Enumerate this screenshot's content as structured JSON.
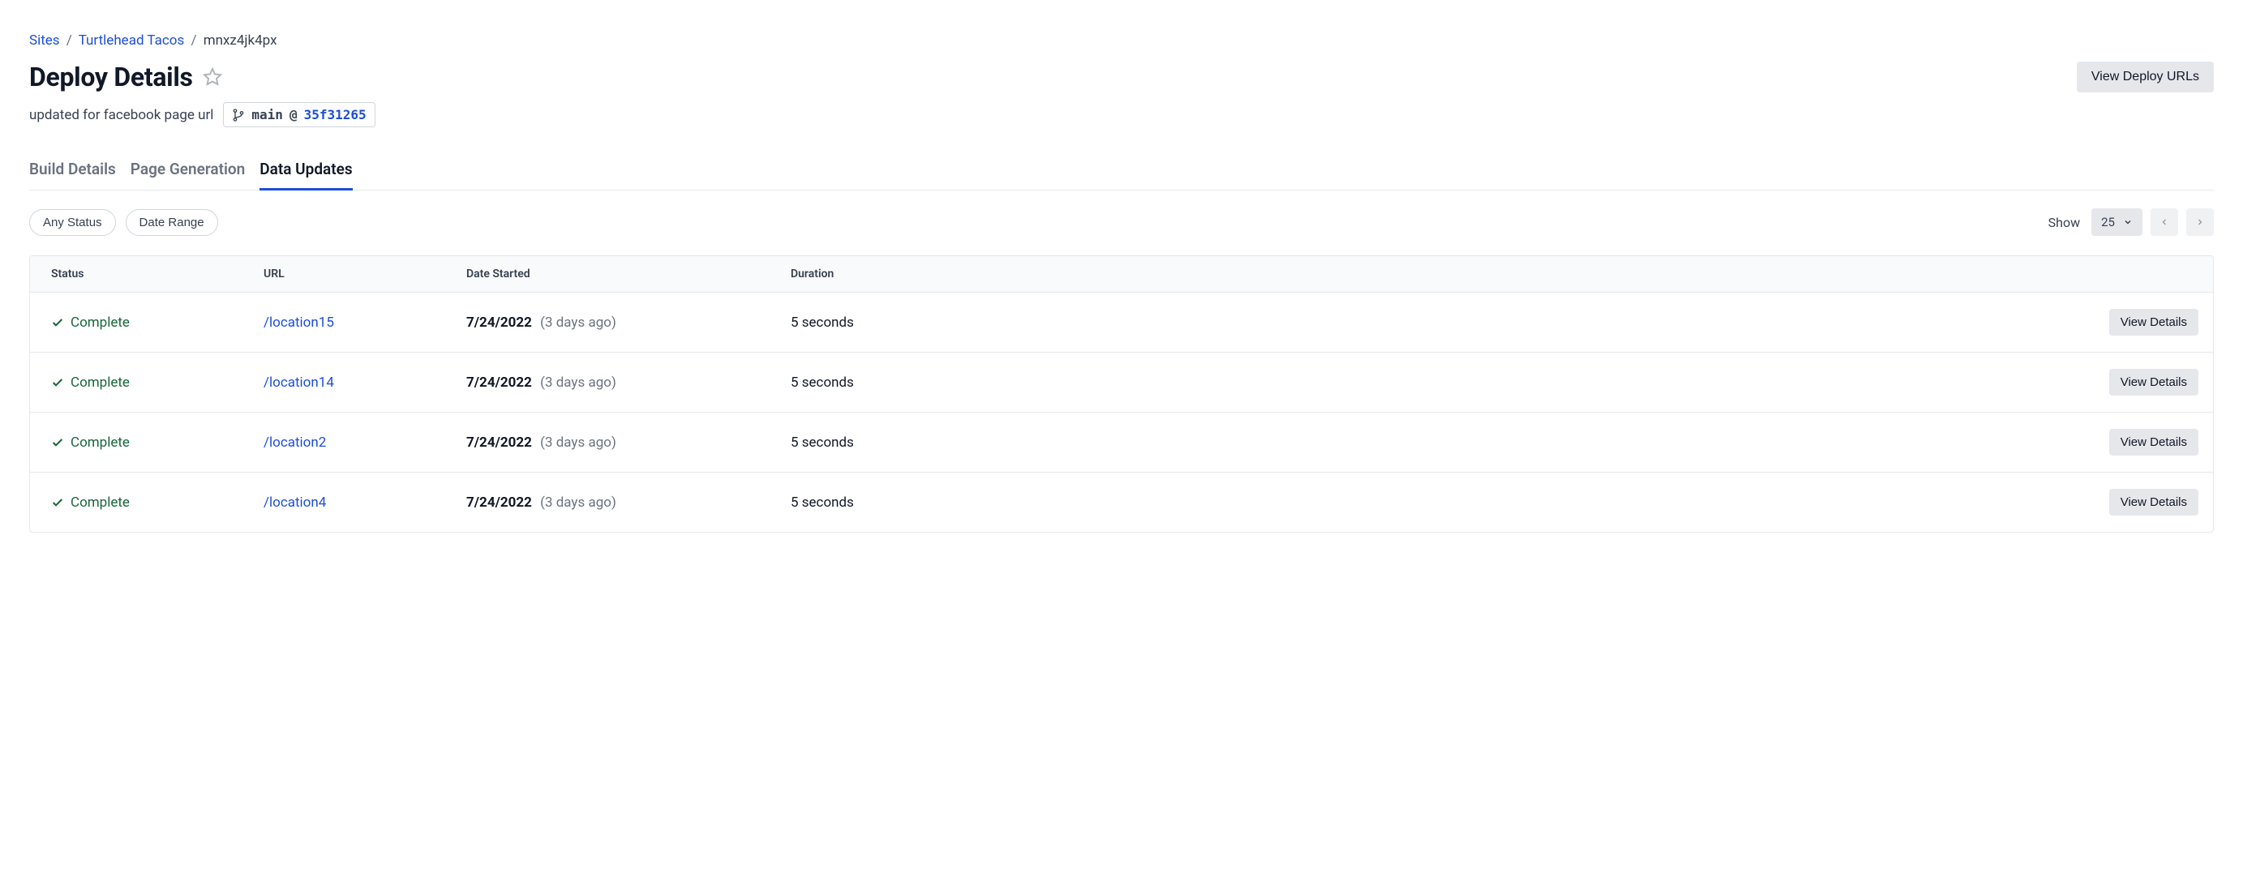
{
  "breadcrumb": {
    "root": "Sites",
    "site": "Turtlehead Tacos",
    "deploy_id": "mnxz4jk4px"
  },
  "header": {
    "title": "Deploy Details",
    "subtitle": "updated for facebook page url",
    "branch": "main",
    "commit": "35f31265",
    "view_urls_label": "View Deploy URLs"
  },
  "tabs": {
    "build": "Build Details",
    "page_gen": "Page Generation",
    "data_updates": "Data Updates"
  },
  "filters": {
    "status": "Any Status",
    "date_range": "Date Range"
  },
  "pager": {
    "show_label": "Show",
    "page_size": "25"
  },
  "columns": {
    "status": "Status",
    "url": "URL",
    "date_started": "Date Started",
    "duration": "Duration"
  },
  "row_labels": {
    "view_details": "View Details"
  },
  "rows": [
    {
      "status": "Complete",
      "url": "/location15",
      "date": "7/24/2022",
      "rel": "(3 days ago)",
      "duration": "5 seconds"
    },
    {
      "status": "Complete",
      "url": "/location14",
      "date": "7/24/2022",
      "rel": "(3 days ago)",
      "duration": "5 seconds"
    },
    {
      "status": "Complete",
      "url": "/location2",
      "date": "7/24/2022",
      "rel": "(3 days ago)",
      "duration": "5 seconds"
    },
    {
      "status": "Complete",
      "url": "/location4",
      "date": "7/24/2022",
      "rel": "(3 days ago)",
      "duration": "5 seconds"
    }
  ]
}
